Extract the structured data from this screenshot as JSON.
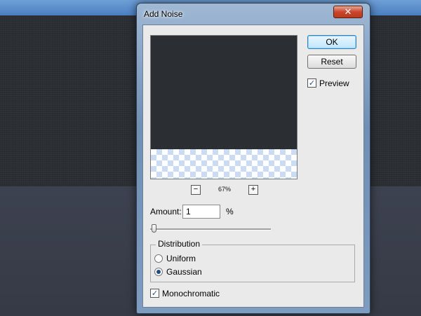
{
  "dialog": {
    "title": "Add Noise",
    "close_symbol": "✕",
    "ok_label": "OK",
    "reset_label": "Reset",
    "preview": {
      "label": "Preview",
      "checked": true,
      "check_symbol": "✓"
    },
    "zoom": {
      "out_symbol": "−",
      "in_symbol": "+",
      "level": "67%"
    },
    "amount": {
      "label": "Amount:",
      "value": "1",
      "unit": "%",
      "slider_fraction": 0.01
    },
    "distribution": {
      "label": "Distribution",
      "options": [
        {
          "label": "Uniform",
          "selected": false
        },
        {
          "label": "Gaussian",
          "selected": true
        }
      ]
    },
    "monochromatic": {
      "label": "Monochromatic",
      "checked": true,
      "check_symbol": "✓"
    }
  },
  "colors": {
    "canvas_dark": "#2b2f34",
    "accent_blue": "#1f4d86",
    "close_red": "#c9462d"
  },
  "icons": [
    "close-icon",
    "zoom-out-icon",
    "zoom-in-icon",
    "checkmark-icon"
  ]
}
